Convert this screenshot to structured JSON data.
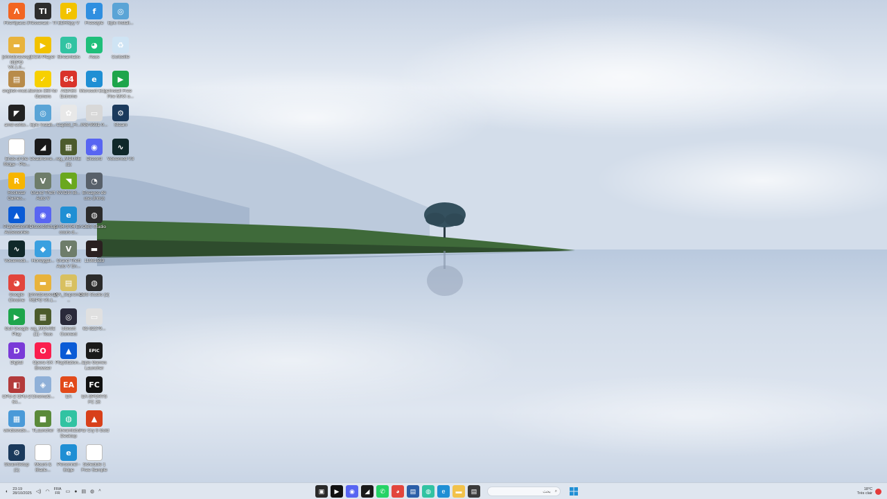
{
  "desktop": {
    "icons": [
      {
        "label": "FireAlpaca 3",
        "glyph": "Λ",
        "bg": "#f26522"
      },
      {
        "label": "Tesseract - TI",
        "glyph": "TI",
        "bg": "#2d2d2d"
      },
      {
        "label": "EDRSpy V",
        "glyph": "P",
        "bg": "#f2c300"
      },
      {
        "label": "Freestyle",
        "glyph": "f",
        "bg": "#2f8fe0"
      },
      {
        "label": "Epic Install...",
        "glyph": "◎",
        "bg": "#5aa4d6"
      },
      {
        "label": "[christbravesy] REPO V0.1.0...",
        "glyph": "▬",
        "bg": "#e8b33c"
      },
      {
        "label": "CCM Player",
        "glyph": "▶",
        "bg": "#f2c200"
      },
      {
        "label": "Streamlabs",
        "glyph": "◍",
        "bg": "#31c3a2"
      },
      {
        "label": "Asus",
        "glyph": "◕",
        "bg": "#1fbf7a"
      },
      {
        "label": "Corbeille",
        "glyph": "♻",
        "bg": "#cfe4f4"
      },
      {
        "label": "english-mod...",
        "glyph": "▤",
        "bg": "#b88b4a"
      },
      {
        "label": "Norton 360 for Gamers",
        "glyph": "✓",
        "bg": "#f7d000"
      },
      {
        "label": "AIDA64 Extreme",
        "glyph": "64",
        "bg": "#d9332b"
      },
      {
        "label": "Microsoft Edge",
        "glyph": "e",
        "bg": "#1f8fd4"
      },
      {
        "label": "Install Free Fire MAX o...",
        "glyph": "▶",
        "bg": "#1ea54b"
      },
      {
        "label": "amd-softw...",
        "glyph": "◤",
        "bg": "#222"
      },
      {
        "label": "Epic Install...",
        "glyph": "◎",
        "bg": "#5aa4d6"
      },
      {
        "label": "Capitol_Fr...",
        "glyph": "✿",
        "bg": "#e8e8e8"
      },
      {
        "label": "INS-9931-0...",
        "glyph": "▭",
        "bg": "#d8d8d8"
      },
      {
        "label": "Steam",
        "glyph": "⚙",
        "bg": "#1b3a5c"
      },
      {
        "label": "Ends of the Ridge - Pie...",
        "glyph": "",
        "bg": "#ffffff"
      },
      {
        "label": "Deadheme...",
        "glyph": "◢",
        "bg": "#1a1a1a"
      },
      {
        "label": "wg_MOUSE (1)",
        "glyph": "▦",
        "bg": "#4c5b2c"
      },
      {
        "label": "Discord",
        "glyph": "◉",
        "bg": "#5865f2"
      },
      {
        "label": "Voicemod V3",
        "glyph": "∿",
        "bg": "#10282a"
      },
      {
        "label": "Rockstar Games...",
        "glyph": "R",
        "bg": "#f7b500"
      },
      {
        "label": "Grand Theft Auto V",
        "glyph": "V",
        "bg": "#6e7d6a"
      },
      {
        "label": "NVIDIA Bi...",
        "glyph": "◥",
        "bg": "#6aa81e"
      },
      {
        "label": "Ensayos de uso (Intro)",
        "glyph": "◔",
        "bg": "#58606a"
      },
      {
        "label": "",
        "glyph": "",
        "bg": "transparent"
      },
      {
        "label": "PlayStation® Accessories",
        "glyph": "▲",
        "bg": "#0a5bd6"
      },
      {
        "label": "DiscordSetup",
        "glyph": "◉",
        "bg": "#5865f2"
      },
      {
        "label": "3-04-3-04 En cours d...",
        "glyph": "e",
        "bg": "#1f8fd4"
      },
      {
        "label": "OBS Studio",
        "glyph": "◍",
        "bg": "#2b2b2b"
      },
      {
        "label": "",
        "glyph": "",
        "bg": "transparent"
      },
      {
        "label": "Voicemodi...",
        "glyph": "∿",
        "bg": "#10282a"
      },
      {
        "label": "Honeygai...",
        "glyph": "◆",
        "bg": "#3aa0e0"
      },
      {
        "label": "Grand Theft Auto V En...",
        "glyph": "V",
        "bg": "#6e7d6a"
      },
      {
        "label": "11981533",
        "glyph": "▬",
        "bg": "#2a2020"
      },
      {
        "label": "",
        "glyph": "",
        "bg": "transparent"
      },
      {
        "label": "Google Chrome",
        "glyph": "◕",
        "bg": "#e2453c"
      },
      {
        "label": "[christbravesy] REPO V0.1...",
        "glyph": "▬",
        "bg": "#e8b33c"
      },
      {
        "label": "PIA_Supreme...",
        "glyph": "▤",
        "bg": "#d8c060"
      },
      {
        "label": "OBS Studio (2)",
        "glyph": "◍",
        "bg": "#2b2b2b"
      },
      {
        "label": "",
        "glyph": "",
        "bg": "transparent"
      },
      {
        "label": "Gull Google Play",
        "glyph": "▶",
        "bg": "#1ea54b"
      },
      {
        "label": "wg_MOUSE (1) - Tous",
        "glyph": "▦",
        "bg": "#4c5b2c"
      },
      {
        "label": "Ubisoft Connect",
        "glyph": "◎",
        "bg": "#2a2a3a"
      },
      {
        "label": "62-82279...",
        "glyph": "▭",
        "bg": "#e0e0e0"
      },
      {
        "label": "",
        "glyph": "",
        "bg": "transparent"
      },
      {
        "label": "Digital",
        "glyph": "D",
        "bg": "#7a3ad8"
      },
      {
        "label": "Opera GX Browser",
        "glyph": "O",
        "bg": "#fa1e4e"
      },
      {
        "label": "PlayStation...",
        "glyph": "▲",
        "bg": "#0a5bd6"
      },
      {
        "label": "Epic Games Launcher",
        "glyph": "EPIC",
        "bg": "#1a1a1a"
      },
      {
        "label": "",
        "glyph": "",
        "bg": "transparent"
      },
      {
        "label": "CPU-Z CPU-Z 64...",
        "glyph": "◧",
        "bg": "#b33b3b"
      },
      {
        "label": "CinemaG...",
        "glyph": "◈",
        "bg": "#8fb0d8"
      },
      {
        "label": "EA",
        "glyph": "EA",
        "bg": "#e24a1a"
      },
      {
        "label": "EA SPORTS FC 26",
        "glyph": "FC",
        "bg": "#111"
      },
      {
        "label": "",
        "glyph": "",
        "bg": "transparent"
      },
      {
        "label": "windowsde...",
        "glyph": "▦",
        "bg": "#4a9ad8"
      },
      {
        "label": "TLauncher",
        "glyph": "■",
        "bg": "#5a8a3a"
      },
      {
        "label": "Streamlabs Desktop",
        "glyph": "◍",
        "bg": "#31c3a2"
      },
      {
        "label": "Far Cry 6 Gold",
        "glyph": "▲",
        "bg": "#d8401a"
      },
      {
        "label": "",
        "glyph": "",
        "bg": "transparent"
      },
      {
        "label": "SteamSetup (1)",
        "glyph": "⚙",
        "bg": "#1b3a5c"
      },
      {
        "label": "Mount & Blade...",
        "glyph": "",
        "bg": "#ffffff"
      },
      {
        "label": "Personnel - Edge",
        "glyph": "e",
        "bg": "#1f8fd4"
      },
      {
        "label": "Schedule 1 Free Sample",
        "glyph": "",
        "bg": "#ffffff"
      },
      {
        "label": "",
        "glyph": "",
        "bg": "transparent"
      }
    ]
  },
  "taskbar": {
    "time": "23:19",
    "date": "28/10/2025",
    "lang_top": "FRA",
    "lang_bottom": "FR",
    "search_placeholder": "بحث",
    "weather_temp": "18°C",
    "weather_desc": "Très clair",
    "apps": [
      {
        "name": "file-manager-icon",
        "glyph": "▣",
        "bg": "#2a2a2a"
      },
      {
        "name": "terminal-icon",
        "glyph": "▶",
        "bg": "#111"
      },
      {
        "name": "discord-taskbar-icon",
        "glyph": "◉",
        "bg": "#5865f2"
      },
      {
        "name": "capcut-icon",
        "glyph": "◢",
        "bg": "#1a1a1a"
      },
      {
        "name": "whatsapp-icon",
        "glyph": "✆",
        "bg": "#25d366"
      },
      {
        "name": "chrome-taskbar-icon",
        "glyph": "◕",
        "bg": "#e2453c"
      },
      {
        "name": "store-icon",
        "glyph": "▤",
        "bg": "#2b5fa8"
      },
      {
        "name": "streamlabs-taskbar-icon",
        "glyph": "◍",
        "bg": "#31c3a2"
      },
      {
        "name": "edge-taskbar-icon",
        "glyph": "e",
        "bg": "#1f8fd4"
      },
      {
        "name": "folder-icon",
        "glyph": "▬",
        "bg": "#f2c24a"
      },
      {
        "name": "notepad-icon",
        "glyph": "▤",
        "bg": "#3a3a3a"
      }
    ],
    "start_color": "#1f8fd4"
  }
}
